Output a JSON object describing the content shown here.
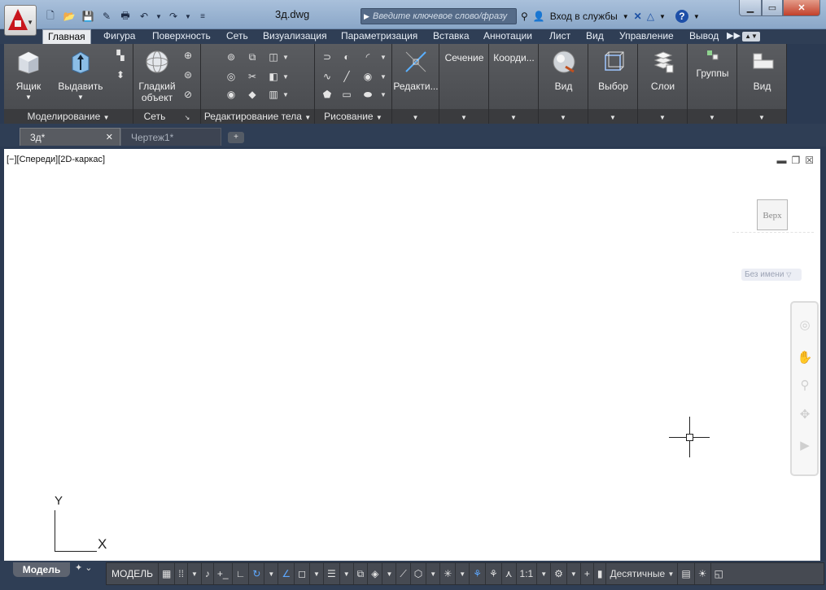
{
  "titlebar": {
    "doc_title": "3д.dwg",
    "search_placeholder": "Введите ключевое слово/фразу",
    "signin_label": "Вход в службы",
    "help_label": "?"
  },
  "ribbon_tabs": [
    {
      "label": "Главная",
      "active": true
    },
    {
      "label": "Фигура"
    },
    {
      "label": "Поверхность"
    },
    {
      "label": "Сеть"
    },
    {
      "label": "Визуализация"
    },
    {
      "label": "Параметризация"
    },
    {
      "label": "Вставка"
    },
    {
      "label": "Аннотации"
    },
    {
      "label": "Лист"
    },
    {
      "label": "Вид"
    },
    {
      "label": "Управление"
    },
    {
      "label": "Вывод"
    }
  ],
  "panels": {
    "modeling": {
      "title": "Моделирование",
      "box": "Ящик",
      "extrude": "Выдавить"
    },
    "mesh": {
      "title": "Сеть",
      "smooth_l1": "Гладкий",
      "smooth_l2": "объект"
    },
    "solid_edit": {
      "title": "Редактирование тела"
    },
    "draw": {
      "title": "Рисование"
    },
    "modify": {
      "label": "Редакти..."
    },
    "section": {
      "label": "Сечение"
    },
    "coords": {
      "label": "Коорди..."
    },
    "view": {
      "label": "Вид"
    },
    "selection": {
      "label": "Выбор"
    },
    "layers": {
      "label": "Слои"
    },
    "groups": {
      "label": "Группы"
    },
    "view2": {
      "label": "Вид"
    }
  },
  "file_tabs": [
    {
      "label": "3д*",
      "active": true
    },
    {
      "label": "Чертеж1*"
    }
  ],
  "viewport": {
    "label": "[−][Спереди][2D-каркас]",
    "cube_face": "Верх",
    "ucs_name": "Без имени",
    "axis_x": "X",
    "axis_y": "Y"
  },
  "statusbar": {
    "model_tab": "Модель",
    "model_btn": "МОДЕЛЬ",
    "scale": "1:1",
    "units": "Десятичные"
  }
}
